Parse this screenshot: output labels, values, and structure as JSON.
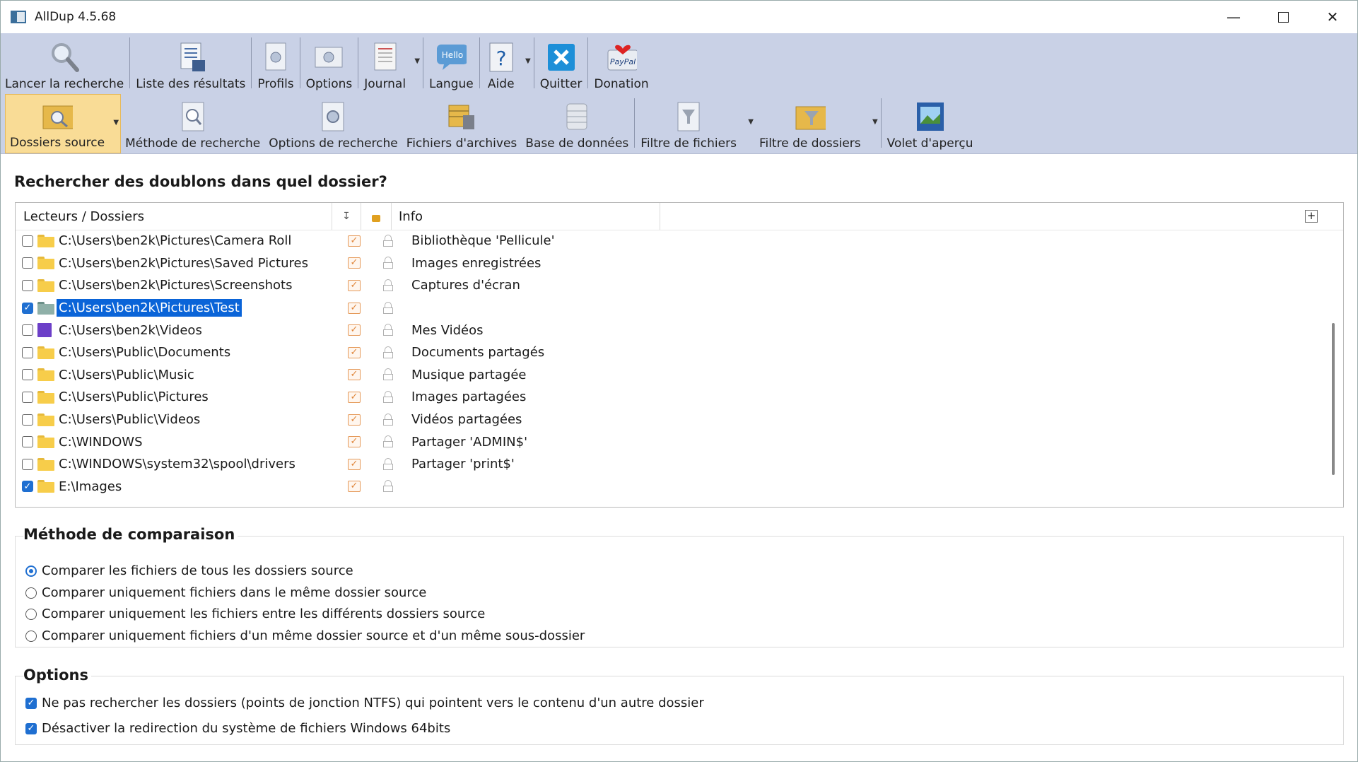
{
  "window": {
    "title": "AllDup 4.5.68"
  },
  "toolbar1": [
    {
      "label": "Lancer la recherche",
      "icon": "magnifier-icon"
    },
    {
      "label": "Liste des résultats",
      "icon": "results-list-icon"
    },
    {
      "label": "Profils",
      "icon": "profiles-icon"
    },
    {
      "label": "Options",
      "icon": "options-icon"
    },
    {
      "label": "Journal",
      "icon": "journal-icon"
    },
    {
      "label": "Langue",
      "icon": "language-icon",
      "badge": "Hello"
    },
    {
      "label": "Aide",
      "icon": "help-icon"
    },
    {
      "label": "Quitter",
      "icon": "quit-icon"
    },
    {
      "label": "Donation",
      "icon": "paypal-icon",
      "badge": "PayPal"
    }
  ],
  "toolbar2": [
    {
      "label": "Dossiers source",
      "icon": "source-folders-icon",
      "active": true
    },
    {
      "label": "Méthode de recherche",
      "icon": "search-method-icon"
    },
    {
      "label": "Options de recherche",
      "icon": "search-options-icon"
    },
    {
      "label": "Fichiers d'archives",
      "icon": "archive-files-icon"
    },
    {
      "label": "Base de données",
      "icon": "database-icon"
    },
    {
      "label": "Filtre de fichiers",
      "icon": "file-filter-icon"
    },
    {
      "label": "Filtre de dossiers",
      "icon": "folder-filter-icon"
    },
    {
      "label": "Volet d'aperçu",
      "icon": "preview-pane-icon"
    }
  ],
  "question": "Rechercher des doublons dans quel dossier?",
  "list": {
    "headers": {
      "folders": "Lecteurs / Dossiers",
      "info": "Info"
    },
    "rows": [
      {
        "path": "C:\\Users\\ben2k\\Pictures\\Camera Roll",
        "info": "Bibliothèque 'Pellicule'",
        "checked": false,
        "folder": "yellow"
      },
      {
        "path": "C:\\Users\\ben2k\\Pictures\\Saved Pictures",
        "info": "Images enregistrées",
        "checked": false,
        "folder": "yellow"
      },
      {
        "path": "C:\\Users\\ben2k\\Pictures\\Screenshots",
        "info": "Captures d'écran",
        "checked": false,
        "folder": "yellow"
      },
      {
        "path": "C:\\Users\\ben2k\\Pictures\\Test",
        "info": "",
        "checked": true,
        "folder": "green",
        "selected": true
      },
      {
        "path": "C:\\Users\\ben2k\\Videos",
        "info": "Mes Vidéos",
        "checked": false,
        "folder": "video"
      },
      {
        "path": "C:\\Users\\Public\\Documents",
        "info": "Documents partagés",
        "checked": false,
        "folder": "yellow"
      },
      {
        "path": "C:\\Users\\Public\\Music",
        "info": "Musique partagée",
        "checked": false,
        "folder": "yellow"
      },
      {
        "path": "C:\\Users\\Public\\Pictures",
        "info": "Images partagées",
        "checked": false,
        "folder": "yellow"
      },
      {
        "path": "C:\\Users\\Public\\Videos",
        "info": "Vidéos partagées",
        "checked": false,
        "folder": "yellow"
      },
      {
        "path": "C:\\WINDOWS",
        "info": "Partager 'ADMIN$'",
        "checked": false,
        "folder": "yellow"
      },
      {
        "path": "C:\\WINDOWS\\system32\\spool\\drivers",
        "info": "Partager 'print$'",
        "checked": false,
        "folder": "yellow"
      },
      {
        "path": "E:\\Images",
        "info": "",
        "checked": true,
        "folder": "yellow"
      }
    ]
  },
  "comparison": {
    "title": "Méthode de comparaison",
    "options": [
      {
        "label": "Comparer les fichiers de tous les dossiers source",
        "selected": true
      },
      {
        "label": "Comparer uniquement fichiers dans le même dossier source",
        "selected": false
      },
      {
        "label": "Comparer uniquement les fichiers entre les différents dossiers source",
        "selected": false
      },
      {
        "label": "Comparer uniquement fichiers d'un même dossier source et d'un même sous-dossier",
        "selected": false
      }
    ]
  },
  "options": {
    "title": "Options",
    "items": [
      {
        "label": "Ne pas rechercher les dossiers (points de jonction NTFS) qui pointent vers le contenu d'un autre dossier",
        "checked": true
      },
      {
        "label": "Désactiver la redirection du système de fichiers Windows 64bits",
        "checked": true
      }
    ]
  },
  "colors": {
    "toolbar_bg": "#c9d1e6",
    "accent": "#1f6fd1",
    "selection": "#0a64d8",
    "active_tab": "#f9dc96"
  }
}
